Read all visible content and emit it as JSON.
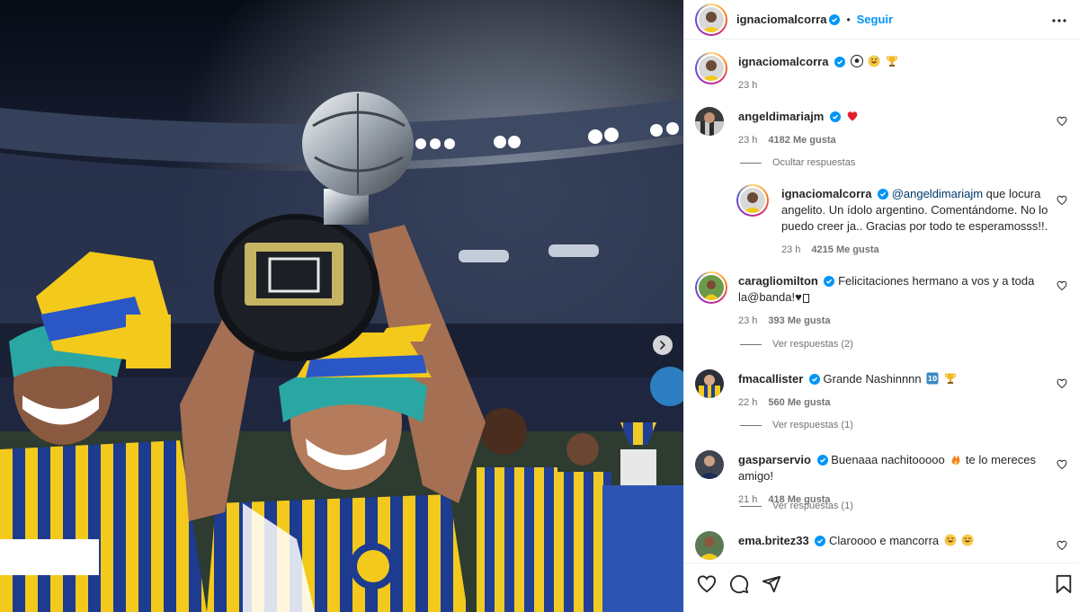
{
  "post": {
    "author": "ignaciomalcorra",
    "follow_label": "Seguir",
    "caption_username": "ignaciomalcorra",
    "caption_emoji": [
      "soccer-ball",
      "grinning-sweat",
      "trophy"
    ],
    "caption_time": "23 h"
  },
  "comments": [
    {
      "username": "angeldimariajm",
      "text": "",
      "emoji": [
        "red-heart"
      ],
      "time": "23 h",
      "likes": "4182 Me gusta",
      "replies_label": "Ocultar respuestas"
    },
    {
      "username": "ignaciomalcorra",
      "mention": "@angeldimariajm",
      "text": " que locura angelito. Un ídolo argentino. Comentándome. No lo puedo creer ja.. Gracias por todo te esperamosss!!.",
      "time": "23 h",
      "likes": "4215 Me gusta",
      "is_reply": true
    },
    {
      "username": "caragliomilton",
      "text": "Felicitaciones hermano a vos y a toda la@banda!♥",
      "time": "23 h",
      "likes": "393 Me gusta",
      "replies_label": "Ver respuestas (2)"
    },
    {
      "username": "fmacallister",
      "text": "Grande Nashinnnn ",
      "emoji": [
        "ten-keycap",
        "trophy"
      ],
      "time": "22 h",
      "likes": "560 Me gusta",
      "replies_label": "Ver respuestas (1)"
    },
    {
      "username": "gasparservio",
      "text": "Buenaaa nachitooooo ",
      "text_after": " te lo mereces amigo!",
      "emoji": [
        "fire"
      ],
      "time": "21 h",
      "likes": "418 Me gusta",
      "replies_label": "Ver respuestas (1)"
    },
    {
      "username": "ema.britez33",
      "text": "Claroooo e mancorra ",
      "emoji": [
        "joy",
        "joy"
      ]
    }
  ],
  "colors": {
    "follow_blue": "#0095f6",
    "verified_blue": "#0095f6",
    "mention": "#00376b",
    "muted": "#737373",
    "heart_red": "#ed4956"
  },
  "icons": [
    "more-icon",
    "heart-icon",
    "comment-icon",
    "share-icon",
    "bookmark-icon",
    "chevron-right-icon",
    "verified-icon"
  ]
}
